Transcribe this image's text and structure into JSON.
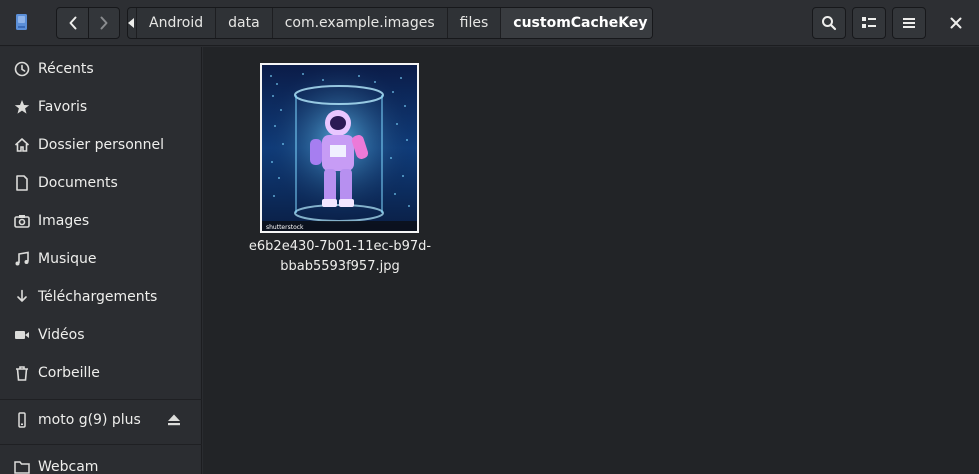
{
  "window": {
    "breadcrumb": [
      "Android",
      "data",
      "com.example.images",
      "files",
      "customCacheKey"
    ],
    "current_folder": "customCacheKey"
  },
  "toolbar": {
    "back_icon": "chevron-left-icon",
    "forward_icon": "chevron-right-icon",
    "search_icon": "search-icon",
    "view_icon": "view-list-icon",
    "menu_icon": "hamburger-menu-icon",
    "close_icon": "close-icon"
  },
  "sidebar": {
    "items": [
      {
        "label": "Récents",
        "icon": "clock-icon"
      },
      {
        "label": "Favoris",
        "icon": "star-icon"
      },
      {
        "label": "Dossier personnel",
        "icon": "home-icon"
      },
      {
        "label": "Documents",
        "icon": "document-icon"
      },
      {
        "label": "Images",
        "icon": "camera-icon"
      },
      {
        "label": "Musique",
        "icon": "music-icon"
      },
      {
        "label": "Téléchargements",
        "icon": "download-icon"
      },
      {
        "label": "Vidéos",
        "icon": "video-icon"
      },
      {
        "label": "Corbeille",
        "icon": "trash-icon"
      }
    ],
    "devices": [
      {
        "label": "moto g(9) plus",
        "icon": "phone-icon"
      },
      {
        "label": "Webcam",
        "icon": "folder-icon"
      }
    ]
  },
  "files": [
    {
      "name_line1": "e6b2e430-7b01-11ec-b97d-",
      "name_line2": "bbab5593f957.jpg",
      "thumbnail_watermark": "shutterstock"
    }
  ],
  "colors": {
    "header_bg": "#2d2f33",
    "sidebar_bg": "#2b2d31",
    "main_bg": "#222427",
    "text": "#eeeeec"
  }
}
